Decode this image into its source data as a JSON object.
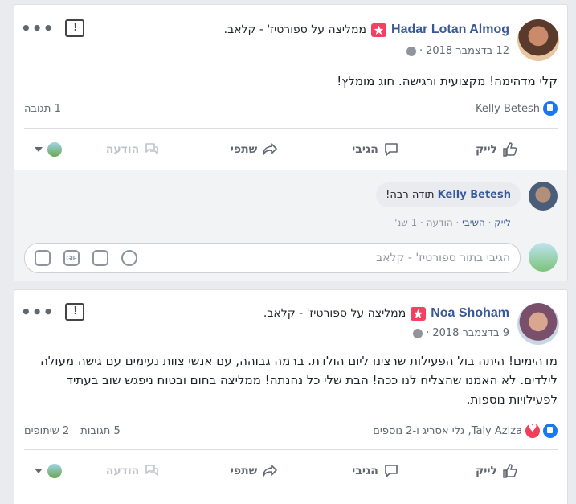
{
  "post1": {
    "author": "Hadar Lotan Almog",
    "recommends": "ממליצה על ספורטיז' - קלאב.",
    "date": "12 בדצמבר 2018",
    "text": "קלי מדהימה! מקצועית ורגישה. חוג מומלץ!",
    "reactors": "Kelly Betesh",
    "comment_count": "1 תגובה",
    "comment": {
      "author": "Kelly Betesh",
      "text": "תודה רבה!",
      "like": "לייק",
      "reply": "השיבי",
      "message": "הודעה",
      "time": "1 שנ'"
    },
    "write_placeholder": "הגיבי בתור ספורטיז' - קלאב"
  },
  "post2": {
    "author": "Noa Shoham",
    "recommends": "ממליצה על ספורטיז' - קלאב.",
    "date": "9 בדצמבר 2018",
    "text": "מדהימים! היתה בול הפעילות שרצינו ליום הולדת. ברמה גבוהה, עם אנשי צוות נעימים עם גישה מעולה לילדים. לא האמנו שהצליח לנו ככה! הבת שלי כל נהנתה! ממליצה בחום ובטוח ניפגש שוב בעתיד לפעילויות נוספות.",
    "reactors": "Taly Aziza, גלי אסריג ו-2 נוספים",
    "comment_count": "5 תגובות",
    "share_count": "2 שיתופים"
  },
  "actions": {
    "like": "לייק",
    "comment": "הגיבי",
    "share": "שתפי",
    "message": "הודעה"
  },
  "icons": {
    "more": "more-dots-icon",
    "report": "report-icon",
    "like": "thumbs-up-icon",
    "comment": "comment-bubble-icon",
    "share": "share-arrow-icon",
    "message": "messenger-icon",
    "globe": "globe-icon",
    "badge": "recommendation-star-icon"
  },
  "colors": {
    "link": "#385898",
    "badge": "#f3425f",
    "like": "#1877f2",
    "love": "#f33e58"
  }
}
